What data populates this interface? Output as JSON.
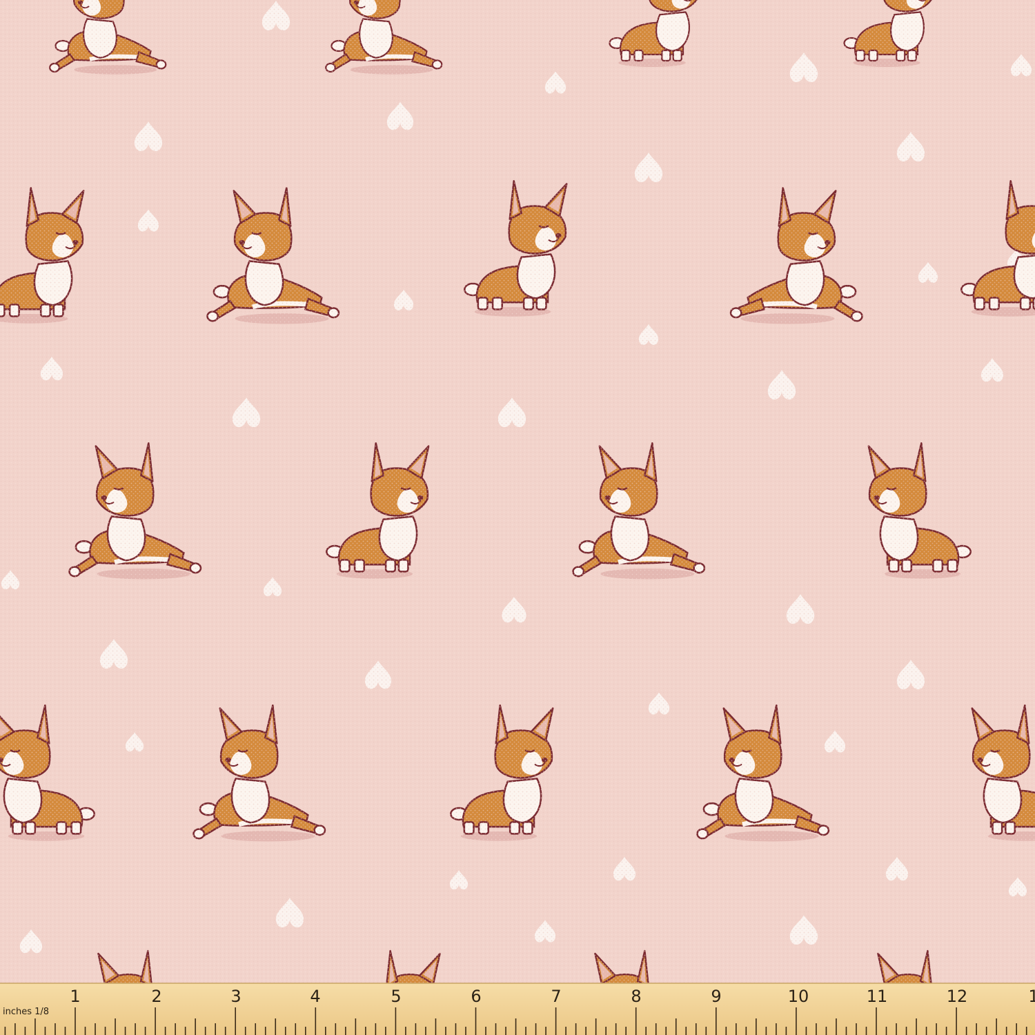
{
  "colors": {
    "fabric": "#f2d3cb",
    "heart": "#fbf3ef",
    "corgi_orange": "#d48a3c",
    "corgi_white": "#fcf5ef",
    "outline": "#7a2a31",
    "ear_inner": "#e8b8ac",
    "shadow": "#e4b8b2",
    "ruler": "#f3d49a"
  },
  "ruler": {
    "unit_label": "inches 1/8",
    "numbers": [
      "1",
      "2",
      "3",
      "4",
      "5",
      "6",
      "7",
      "8",
      "9",
      "10",
      "11",
      "12",
      "1"
    ]
  }
}
